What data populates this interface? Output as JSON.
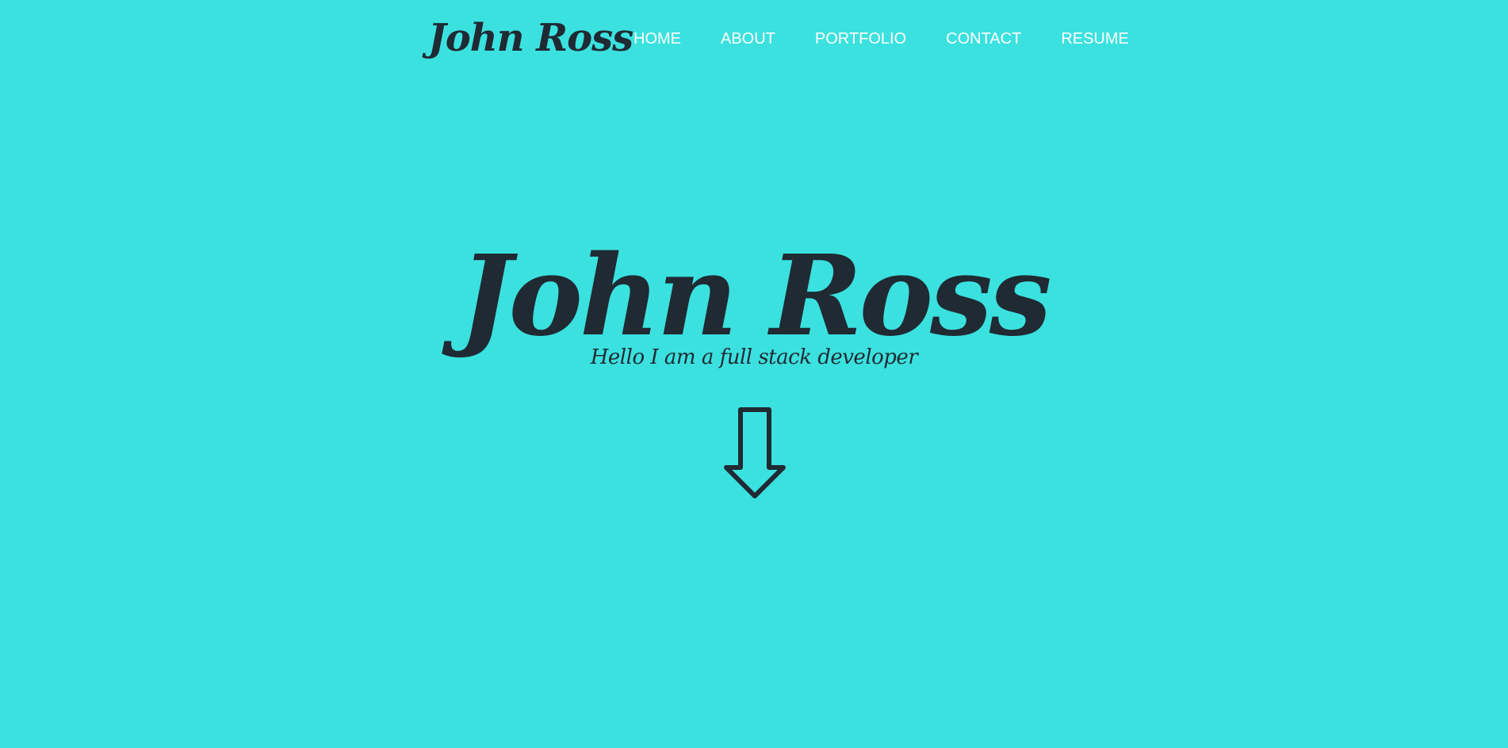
{
  "navbar": {
    "brand": "John Ross",
    "items": [
      {
        "label": "HOME"
      },
      {
        "label": "ABOUT"
      },
      {
        "label": "PORTFOLIO"
      },
      {
        "label": "CONTACT"
      },
      {
        "label": "RESUME"
      }
    ]
  },
  "hero": {
    "title": "John Ross",
    "subtitle": "Hello I am a full stack developer",
    "scroll_icon": "arrow-down-icon"
  },
  "colors": {
    "background": "#3be1df",
    "text_dark": "#1f2a33",
    "nav_text": "#ffffff"
  }
}
